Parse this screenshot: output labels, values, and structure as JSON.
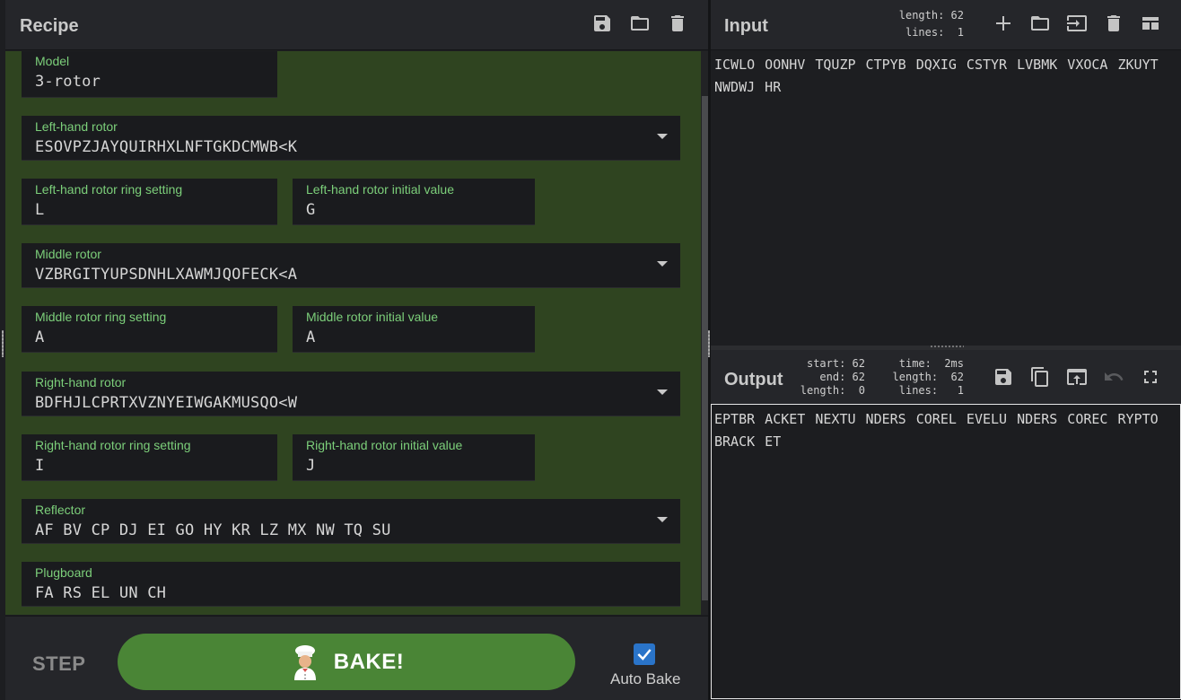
{
  "recipe": {
    "title": "Recipe",
    "fields": {
      "model": {
        "label": "Model",
        "value": "3-rotor"
      },
      "left_rotor": {
        "label": "Left-hand rotor",
        "value": "ESOVPZJAYQUIRHXLNFTGKDCMWB<K"
      },
      "left_ring": {
        "label": "Left-hand rotor ring setting",
        "value": "L"
      },
      "left_init": {
        "label": "Left-hand rotor initial value",
        "value": "G"
      },
      "middle_rotor": {
        "label": "Middle rotor",
        "value": "VZBRGITYUPSDNHLXAWMJQOFECK<A"
      },
      "middle_ring": {
        "label": "Middle rotor ring setting",
        "value": "A"
      },
      "middle_init": {
        "label": "Middle rotor initial value",
        "value": "A"
      },
      "right_rotor": {
        "label": "Right-hand rotor",
        "value": "BDFHJLCPRTXVZNYEIWGAKMUSQO<W"
      },
      "right_ring": {
        "label": "Right-hand rotor ring setting",
        "value": "I"
      },
      "right_init": {
        "label": "Right-hand rotor initial value",
        "value": "J"
      },
      "reflector": {
        "label": "Reflector",
        "value": "AF BV CP DJ EI GO HY KR LZ MX NW TQ SU"
      },
      "plugboard": {
        "label": "Plugboard",
        "value": "FA RS EL UN CH"
      }
    },
    "footer": {
      "step_label": "STEP",
      "bake_label": "BAKE!",
      "autobake_label": "Auto Bake",
      "autobake_checked": true
    }
  },
  "input": {
    "title": "Input",
    "stats": {
      "length": "length: 62",
      "lines": "lines:  1"
    },
    "text": "ICWLO OONHV TQUZP CTPYB DQXIG CSTYR LVBMK VXOCA ZKUYT NWDWJ HR"
  },
  "output": {
    "title": "Output",
    "stats": {
      "start": "start: 62",
      "end": "end: 62",
      "length_sel": "length:  0",
      "time": "time:  2ms",
      "length": "length:  62",
      "lines": "lines:   1"
    },
    "text": "EPTBR ACKET NEXTU NDERS COREL EVELU NDERS COREC RYPTO BRACK ET"
  },
  "colors": {
    "recipe_bg": "#2f4420",
    "label_green": "#7ccf7a",
    "bake_green": "#4a8536",
    "checkbox_blue": "#2a74c9"
  },
  "icons": [
    "save-icon",
    "folder-icon",
    "trash-icon",
    "plus-icon",
    "input-icon",
    "layout-icon",
    "copy-icon",
    "replace-input-icon",
    "undo-icon",
    "maximize-icon",
    "chef-icon"
  ]
}
